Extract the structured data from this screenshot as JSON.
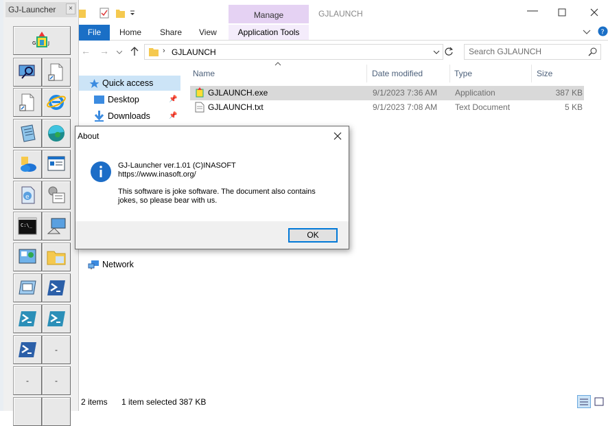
{
  "launcher": {
    "title": "GJ-Launcher",
    "close_glyph": "×",
    "buttons": [
      {
        "icon": "gj-logo-icon",
        "label": "G  J"
      },
      {
        "icon": "magnifier-monitor-icon"
      },
      {
        "icon": "blank-document-icon"
      },
      {
        "icon": "blank-document-icon"
      },
      {
        "icon": "internet-explorer-icon"
      },
      {
        "icon": "notepad-icon"
      },
      {
        "icon": "edge-icon"
      },
      {
        "icon": "onedrive-icon"
      },
      {
        "icon": "system-info-icon"
      },
      {
        "icon": "registry-icon"
      },
      {
        "icon": "settings-list-icon"
      },
      {
        "icon": "command-prompt-icon",
        "label": "C:\\_"
      },
      {
        "icon": "remote-desktop-icon"
      },
      {
        "icon": "control-panel-icon"
      },
      {
        "icon": "folder-icon"
      },
      {
        "icon": "window-icon"
      },
      {
        "icon": "powershell-icon"
      },
      {
        "icon": "powershell-icon"
      },
      {
        "icon": "powershell-icon"
      },
      {
        "icon": "powershell-icon"
      },
      {
        "dash": "-"
      },
      {
        "dash": "-"
      },
      {
        "dash": "-"
      }
    ]
  },
  "explorer": {
    "manage_tab": "Manage",
    "window_title": "GJLAUNCH",
    "tabs": {
      "file": "File",
      "home": "Home",
      "share": "Share",
      "view": "View",
      "app_tools": "Application Tools"
    },
    "address": {
      "path": "GJLAUNCH"
    },
    "search": {
      "placeholder": "Search GJLAUNCH"
    },
    "nav": {
      "quick_access": "Quick access",
      "desktop": "Desktop",
      "downloads": "Downloads",
      "network": "Network"
    },
    "columns": {
      "name": "Name",
      "date": "Date modified",
      "type": "Type",
      "size": "Size"
    },
    "files": [
      {
        "name": "GJLAUNCH.exe",
        "date": "9/1/2023 7:36 AM",
        "type": "Application",
        "size": "387 KB"
      },
      {
        "name": "GJLAUNCH.txt",
        "date": "9/1/2023 7:08 AM",
        "type": "Text Document",
        "size": "5 KB"
      }
    ],
    "status": {
      "items": "2 items",
      "selected": "1 item selected",
      "size": "387 KB"
    }
  },
  "dialog": {
    "title": "About",
    "line1": "GJ-Launcher ver.1.01 (C)INASOFT",
    "line2": "https://www.inasoft.org/",
    "message1": "This software is joke software. The document also contains",
    "message2": "jokes, so please bear with us.",
    "ok": "OK"
  },
  "colors": {
    "file_tab": "#1a6fc6",
    "manage_tab": "#e5d2f3",
    "selection": "#cce4f7",
    "info_icon": "#1c6dc7"
  }
}
